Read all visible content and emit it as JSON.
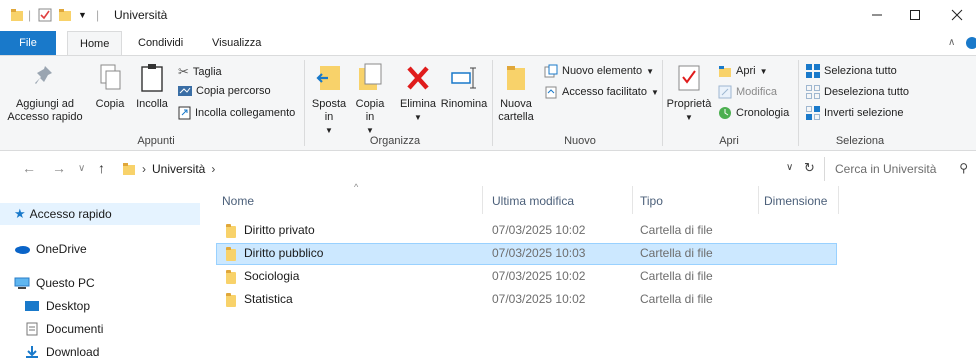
{
  "window": {
    "title": "Università"
  },
  "ribbon_tabs": [
    {
      "label": "File"
    },
    {
      "label": "Home"
    },
    {
      "label": "Condividi"
    },
    {
      "label": "Visualizza"
    }
  ],
  "ribbon": {
    "appunti": {
      "label": "Appunti",
      "aggiungi": "Aggiungi ad Accesso rapido",
      "copia": "Copia",
      "incolla": "Incolla",
      "taglia": "Taglia",
      "copia_percorso": "Copia percorso",
      "incolla_collegamento": "Incolla collegamento"
    },
    "organizza": {
      "label": "Organizza",
      "sposta": "Sposta in",
      "copia_in": "Copia in",
      "elimina": "Elimina",
      "rinomina": "Rinomina"
    },
    "nuovo": {
      "label": "Nuovo",
      "nuova_cartella": "Nuova cartella",
      "nuovo_elemento": "Nuovo elemento",
      "accesso_facilitato": "Accesso facilitato"
    },
    "apri": {
      "label": "Apri",
      "proprieta": "Proprietà",
      "apri": "Apri",
      "modifica": "Modifica",
      "cronologia": "Cronologia"
    },
    "seleziona": {
      "label": "Seleziona",
      "seleziona_tutto": "Seleziona tutto",
      "deseleziona_tutto": "Deseleziona tutto",
      "inverti": "Inverti selezione"
    }
  },
  "address": {
    "path": "Università",
    "search_placeholder": "Cerca in Università"
  },
  "nav": [
    {
      "label": "Accesso rapido",
      "icon": "star-icon"
    },
    {
      "label": "OneDrive",
      "icon": "cloud-icon"
    },
    {
      "label": "Questo PC",
      "icon": "computer-icon"
    },
    {
      "label": "Desktop",
      "icon": "desktop-icon"
    },
    {
      "label": "Documenti",
      "icon": "document-icon"
    },
    {
      "label": "Download",
      "icon": "download-icon"
    }
  ],
  "columns": [
    "Nome",
    "Ultima modifica",
    "Tipo",
    "Dimensione"
  ],
  "files": [
    {
      "name": "Diritto privato",
      "modified": "07/03/2025 10:02",
      "type": "Cartella di file"
    },
    {
      "name": "Diritto pubblico",
      "modified": "07/03/2025 10:03",
      "type": "Cartella di file"
    },
    {
      "name": "Sociologia",
      "modified": "07/03/2025 10:02",
      "type": "Cartella di file"
    },
    {
      "name": "Statistica",
      "modified": "07/03/2025 10:02",
      "type": "Cartella di file"
    }
  ]
}
